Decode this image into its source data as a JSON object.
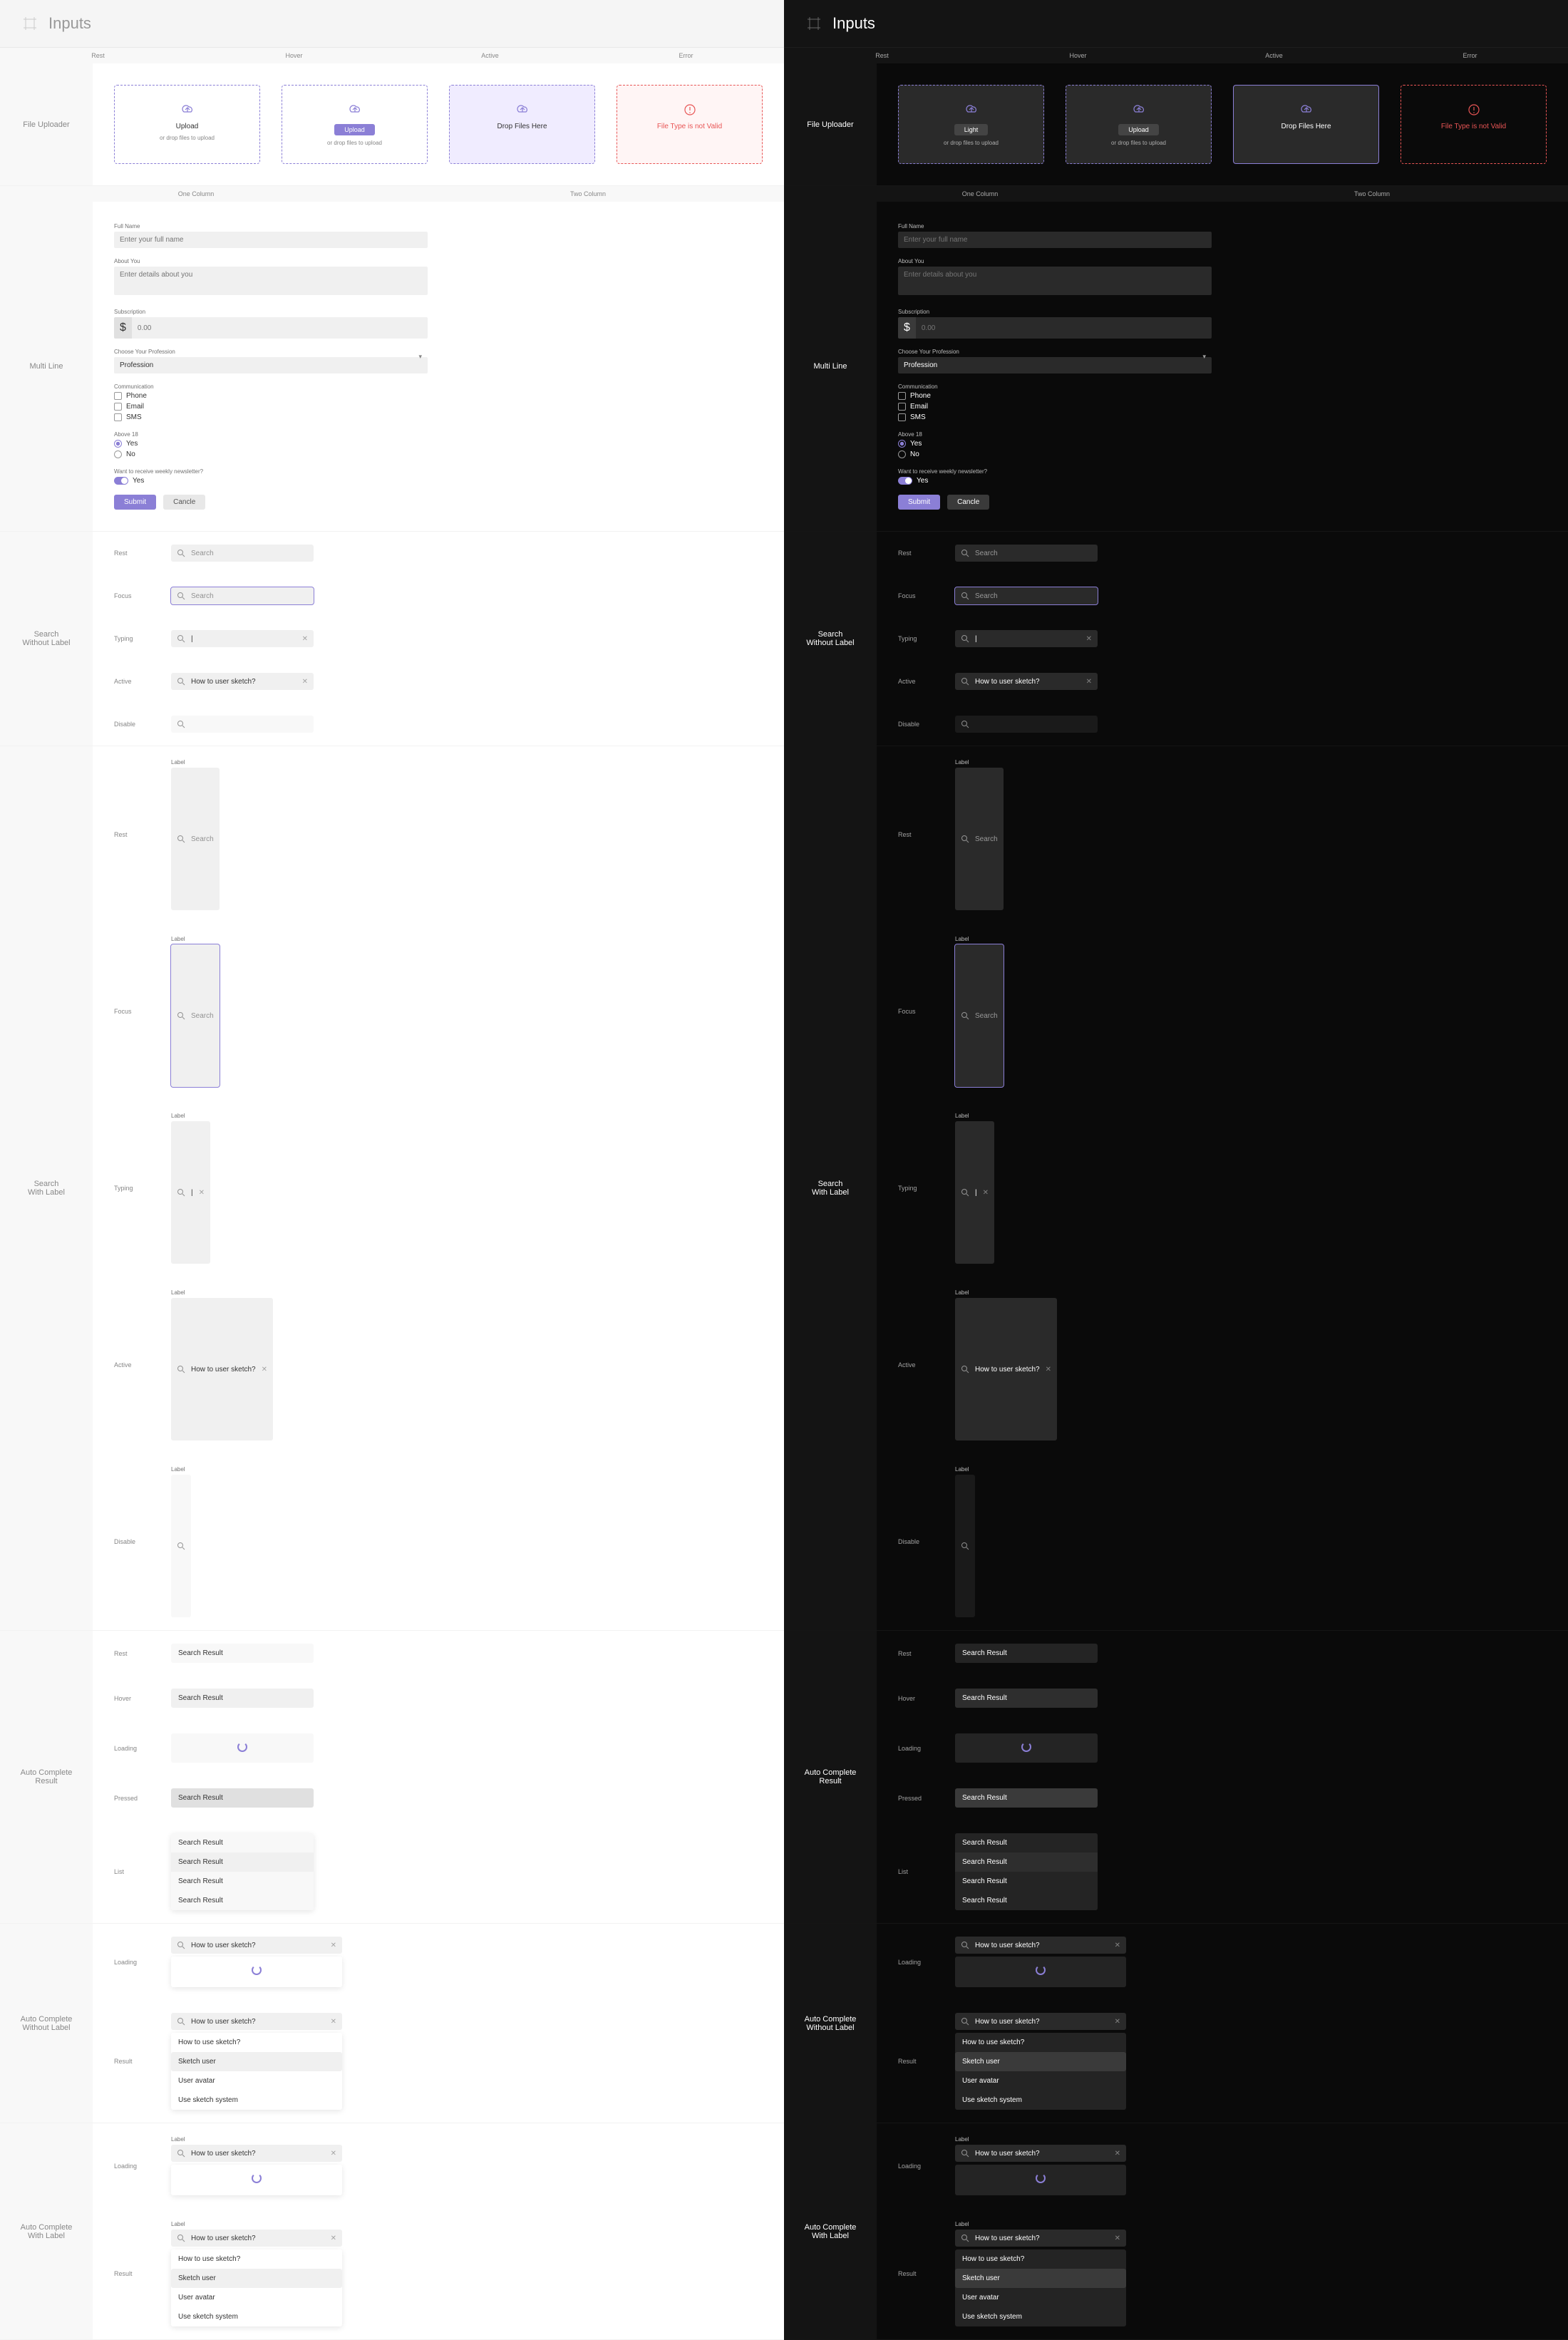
{
  "title": "Inputs",
  "states": {
    "rest": "Rest",
    "hover": "Hover",
    "active": "Active",
    "error": "Error",
    "focus": "Focus",
    "typing": "Typing",
    "disable": "Disable",
    "loading": "Loading",
    "pressed": "Pressed",
    "list": "List",
    "result": "Result"
  },
  "sections": {
    "file_uploader": "File Uploader",
    "multi_line": "Multi Line",
    "search_without_label": "Search\nWithout Label",
    "search_with_label": "Search\nWith Label",
    "auto_complete_result": "Auto Complete\nResult",
    "auto_complete_without_label": "Auto Complete\nWithout Label",
    "auto_complete_with_label": "Auto Complete\nWith Label"
  },
  "cols": {
    "one": "One Column",
    "two": "Two Column"
  },
  "uploader": {
    "upload": "Upload",
    "light_btn": "Light",
    "drop_sub": "or drop files to upload",
    "drop_active": "Drop Files Here",
    "error": "File Type is not Valid"
  },
  "form": {
    "full_name": {
      "label": "Full Name",
      "placeholder": "Enter your full name"
    },
    "about": {
      "label": "About You",
      "placeholder": "Enter details about you"
    },
    "subscription": {
      "label": "Subscription",
      "prefix": "$",
      "placeholder": "0.00"
    },
    "profession": {
      "label": "Choose Your Profession",
      "value": "Profession"
    },
    "communication": {
      "label": "Communication",
      "phone": "Phone",
      "email": "Email",
      "sms": "SMS"
    },
    "above18": {
      "label": "Above 18",
      "yes": "Yes",
      "no": "No"
    },
    "newsletter": {
      "label": "Want to receive weekly newsletter?",
      "yes": "Yes"
    },
    "submit": "Submit",
    "cancel": "Cancle"
  },
  "search": {
    "placeholder": "Search",
    "typing_value": "|",
    "active_value": "How to user sketch?",
    "label": "Label"
  },
  "autocomplete": {
    "result": "Search Result",
    "items": [
      "How to use sketch?",
      "Sketch user",
      "User avatar",
      "Use sketch system"
    ]
  }
}
